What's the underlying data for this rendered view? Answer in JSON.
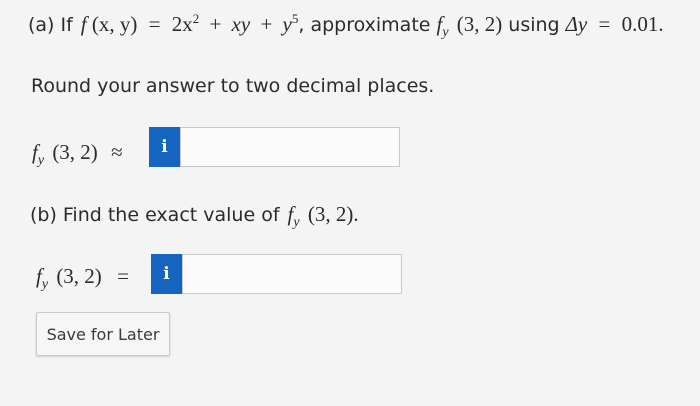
{
  "part_a": {
    "label": "(a)",
    "prefix": "If",
    "fn_name": "f",
    "fn_args": "(x, y)",
    "equals": "=",
    "term1_coef": "2x",
    "term1_exp": "2",
    "plus1": "+",
    "term2": "xy",
    "plus2": "+",
    "term3": "y",
    "term3_exp": "5",
    "approx_text": ", approximate",
    "deriv_fn": "f",
    "deriv_sub": "y",
    "deriv_args": "(3, 2)",
    "using_text": "using",
    "delta": "Δy",
    "delta_equals": "=",
    "delta_value": "0.01."
  },
  "instruction": "Round your answer to two decimal places.",
  "answer_a": {
    "fn": "f",
    "sub": "y",
    "args": "(3, 2)",
    "symbol": "≈",
    "info_icon": "i",
    "value": ""
  },
  "part_b": {
    "label": "(b)",
    "text": "Find the exact value of",
    "fn": "f",
    "sub": "y",
    "args": "(3, 2)."
  },
  "answer_b": {
    "fn": "f",
    "sub": "y",
    "args": "(3, 2)",
    "symbol": "=",
    "info_icon": "i",
    "value": ""
  },
  "save_button": {
    "label": "Save for Later"
  },
  "colors": {
    "background": "#f4f4f4",
    "info_button": "#1565c0"
  }
}
